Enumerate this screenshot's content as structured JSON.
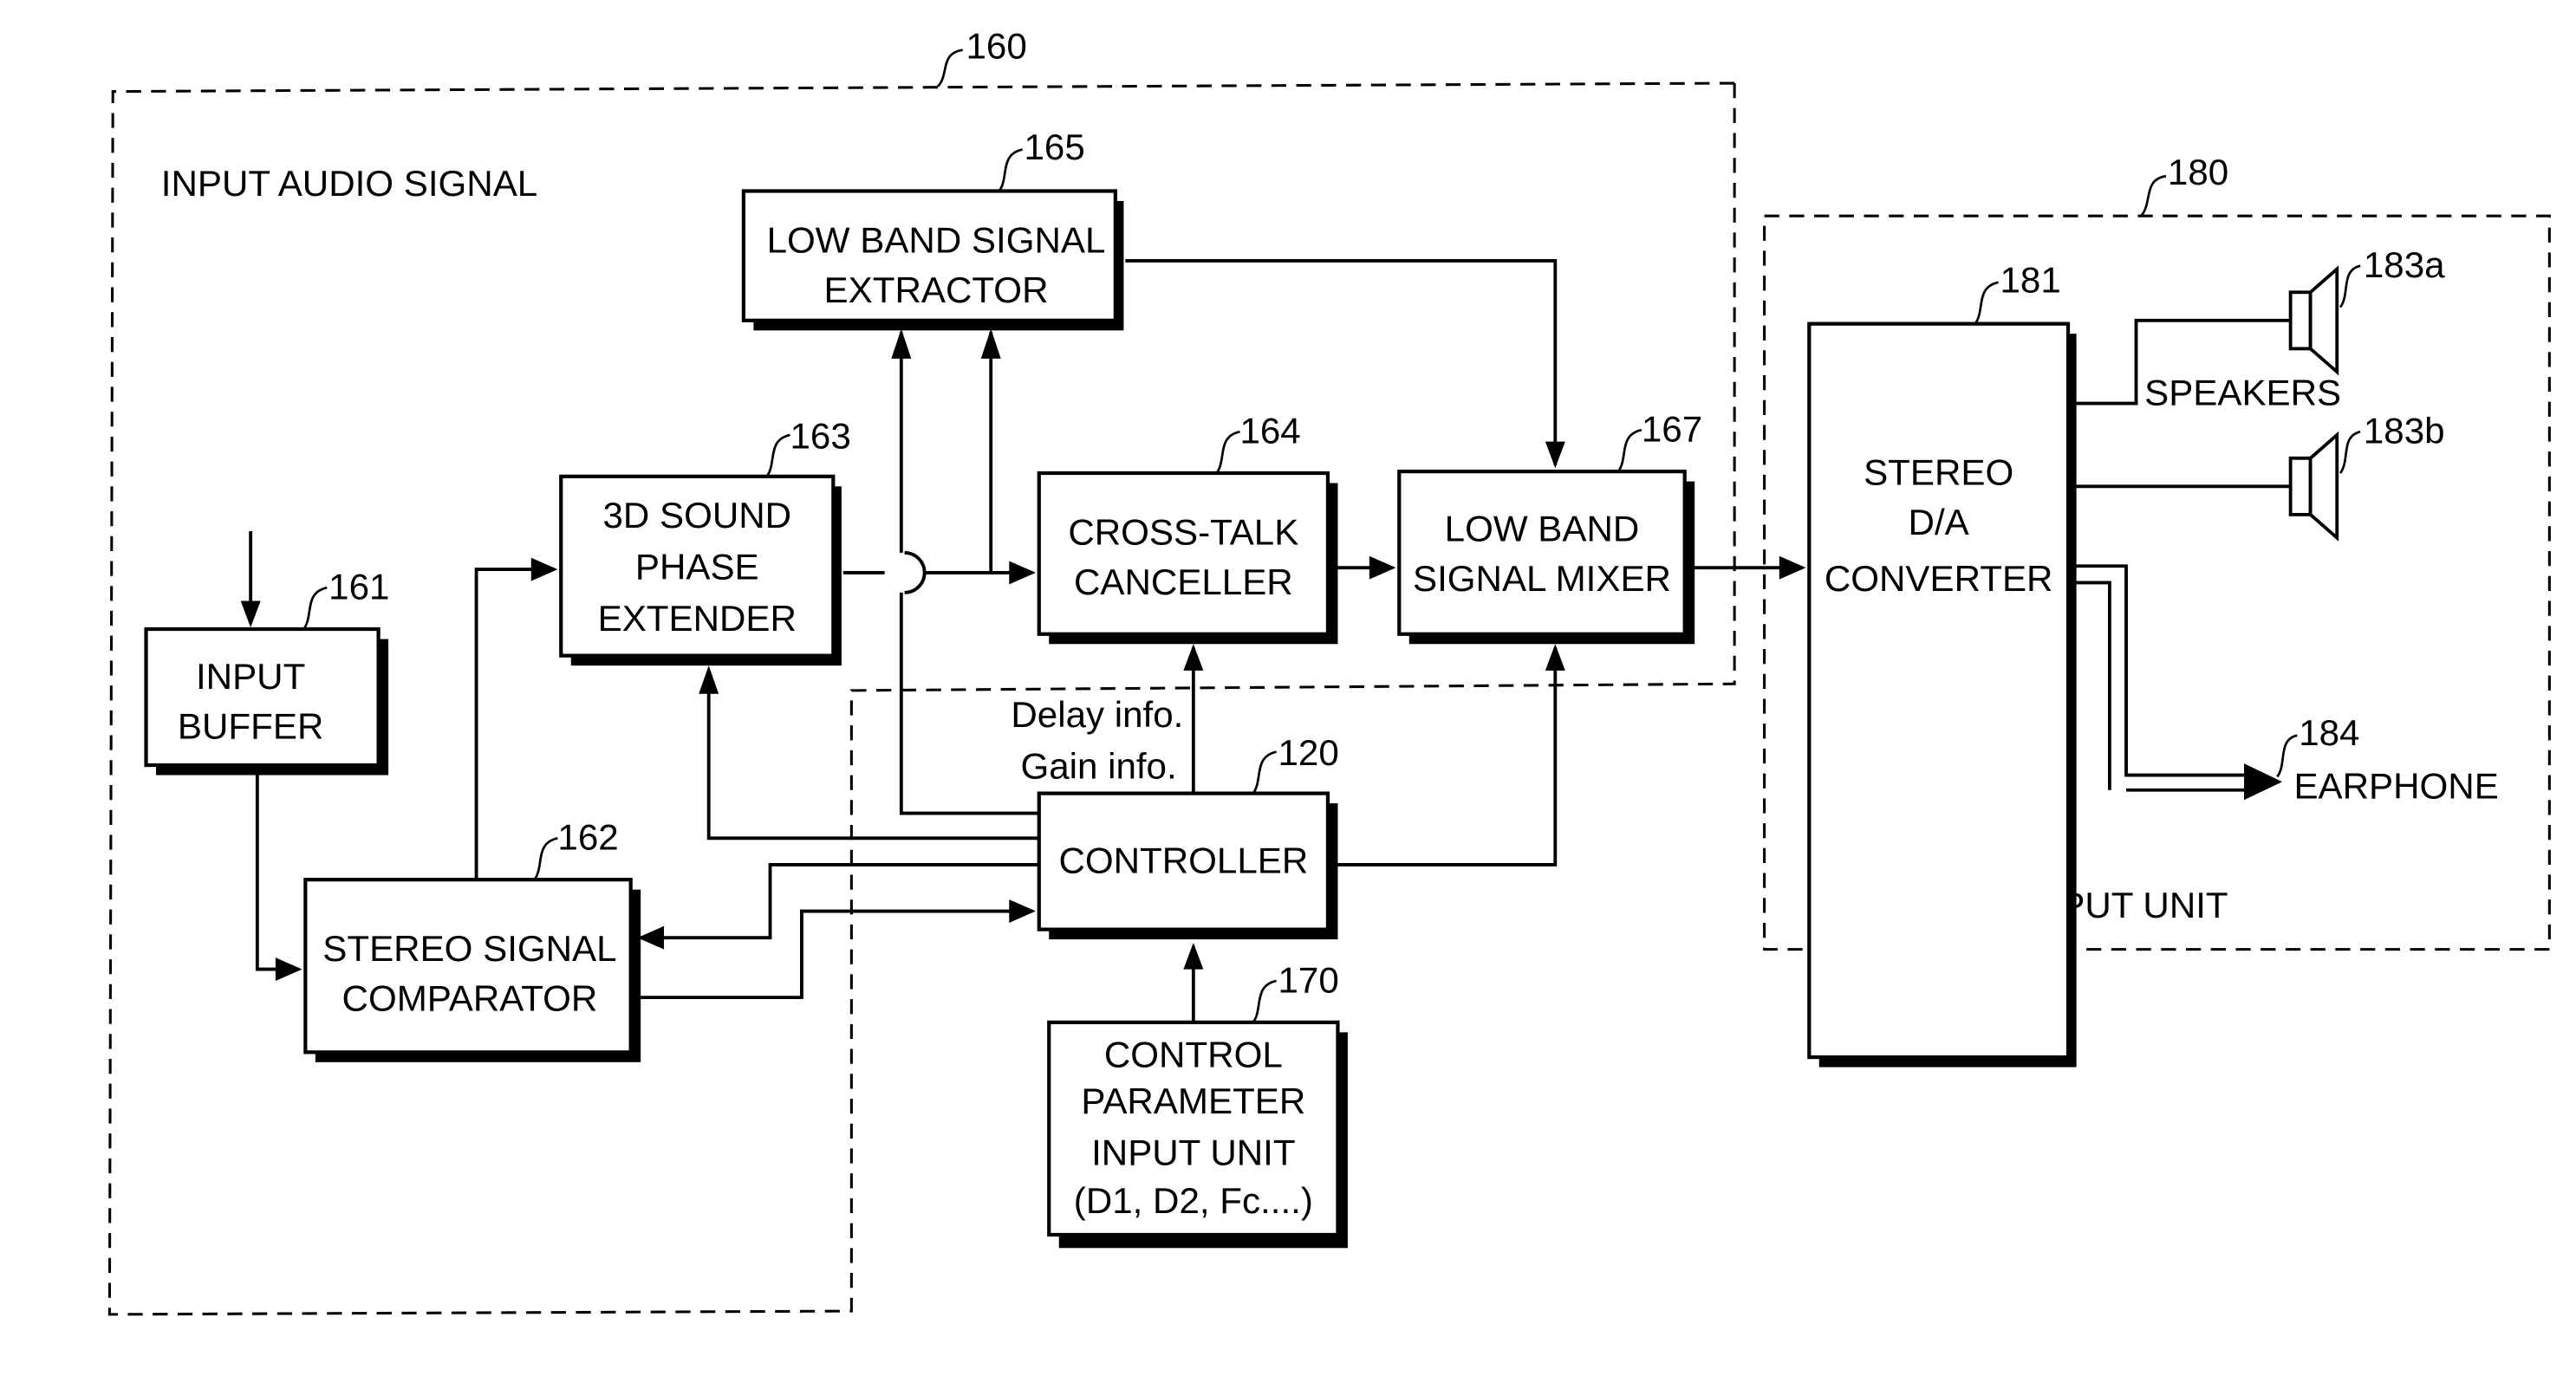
{
  "diagram": {
    "groups": {
      "g160": {
        "ref": "160",
        "title": "INPUT AUDIO SIGNAL"
      },
      "g180": {
        "ref": "180",
        "title": "OUTPUT UNIT"
      }
    },
    "blocks": {
      "b161": {
        "ref": "161",
        "lines": [
          "INPUT",
          "BUFFER"
        ]
      },
      "b162": {
        "ref": "162",
        "lines": [
          "STEREO SIGNAL",
          "COMPARATOR"
        ]
      },
      "b163": {
        "ref": "163",
        "lines": [
          "3D SOUND",
          "PHASE",
          "EXTENDER"
        ]
      },
      "b164": {
        "ref": "164",
        "lines": [
          "CROSS-TALK",
          "CANCELLER"
        ]
      },
      "b165": {
        "ref": "165",
        "lines": [
          "LOW BAND SIGNAL",
          "EXTRACTOR"
        ]
      },
      "b167": {
        "ref": "167",
        "lines": [
          "LOW BAND",
          "SIGNAL MIXER"
        ]
      },
      "b120": {
        "ref": "120",
        "lines": [
          "CONTROLLER"
        ]
      },
      "b170": {
        "ref": "170",
        "lines": [
          "CONTROL",
          "PARAMETER",
          "INPUT UNIT",
          "(D1, D2, Fc....)"
        ]
      },
      "b181": {
        "ref": "181",
        "lines": [
          "STEREO",
          "D/A",
          "CONVERTER"
        ]
      }
    },
    "annotations": {
      "delay": "Delay info.",
      "gain": "Gain info.",
      "speakers": "SPEAKERS",
      "earphone": "EARPHONE"
    },
    "devices": {
      "spk_a": {
        "ref": "183a"
      },
      "spk_b": {
        "ref": "183b"
      },
      "earphone": {
        "ref": "184"
      }
    }
  }
}
